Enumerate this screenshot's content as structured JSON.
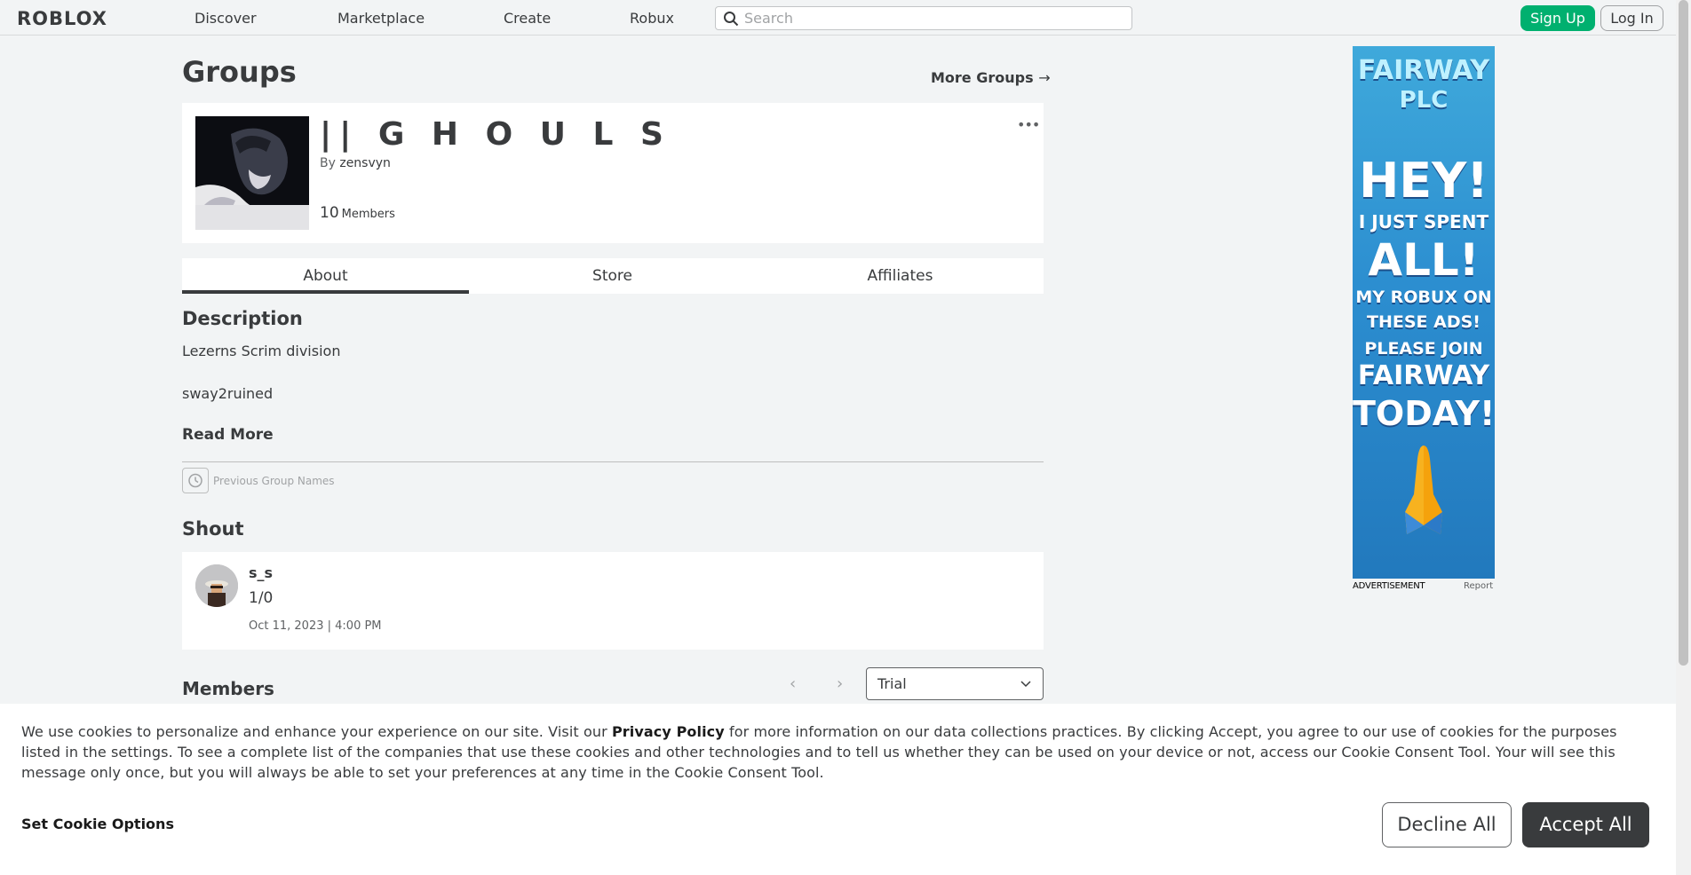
{
  "nav": {
    "logo": "ROBLOX",
    "links": [
      "Discover",
      "Marketplace",
      "Create",
      "Robux"
    ],
    "search_placeholder": "Search",
    "signup": "Sign Up",
    "login": "Log In"
  },
  "page": {
    "title": "Groups",
    "more_groups": "More Groups",
    "more_groups_arrow": "→"
  },
  "group": {
    "name": "|| G H O U L S",
    "by_label": "By",
    "owner": "zensvyn",
    "member_count": "10",
    "member_label": "Members",
    "more_menu": "•••"
  },
  "tabs": [
    "About",
    "Store",
    "Affiliates"
  ],
  "about": {
    "description_title": "Description",
    "description_lines": [
      "Lezerns Scrim division",
      "sway2ruined"
    ],
    "read_more": "Read More",
    "previous_names": "Previous Group Names"
  },
  "shout": {
    "title": "Shout",
    "user": "s_s",
    "message": "1/0",
    "date": "Oct 11, 2023 | 4:00 PM"
  },
  "members": {
    "title": "Members",
    "prev": "‹",
    "next": "›",
    "role": "Trial"
  },
  "ad": {
    "lines": [
      "FAIRWAY",
      "PLC",
      "HEY!",
      "I JUST SPENT",
      "ALL!",
      "MY ROBUX ON",
      "THESE ADS!",
      "PLEASE JOIN",
      "FAIRWAY",
      "TODAY!"
    ],
    "label": "ADVERTISEMENT",
    "report": "Report"
  },
  "cookie": {
    "text_before": "We use cookies to personalize and enhance your experience on our site. Visit our ",
    "policy_link": "Privacy Policy",
    "text_after": " for more information on our data collections practices. By clicking Accept, you agree to our use of cookies for the purposes listed in the settings. To see a complete list of the companies that use these cookies and other technologies and to tell us whether they can be used on your device or not, access our Cookie Consent Tool. Your will see this message only once, but you will always be able to set your preferences at any time in the Cookie Consent Tool.",
    "set_options": "Set Cookie Options",
    "decline": "Decline All",
    "accept": "Accept All"
  }
}
